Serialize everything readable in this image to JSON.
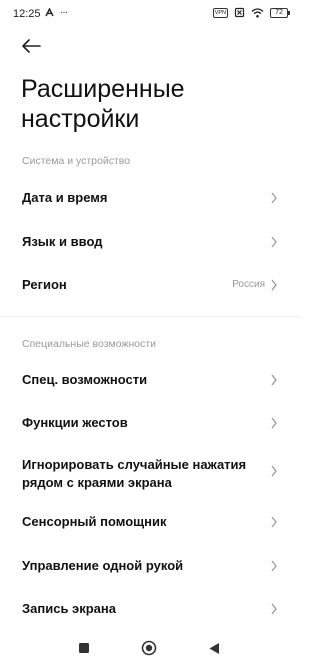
{
  "status_bar": {
    "time": "12:25",
    "vpn": "VPN",
    "battery": "72",
    "more_dots": "···"
  },
  "page": {
    "title": "Расширенные настройки"
  },
  "sections": [
    {
      "header": "Система и устройство",
      "items": [
        {
          "label": "Дата и время",
          "value": ""
        },
        {
          "label": "Язык и ввод",
          "value": ""
        },
        {
          "label": "Регион",
          "value": "Россия"
        }
      ]
    },
    {
      "header": "Специальные возможности",
      "items": [
        {
          "label": "Спец. возможности",
          "value": ""
        },
        {
          "label": "Функции жестов",
          "value": ""
        },
        {
          "label": "Игнорировать случайные нажатия рядом с краями экрана",
          "value": ""
        },
        {
          "label": "Сенсорный помощник",
          "value": ""
        },
        {
          "label": "Управление одной рукой",
          "value": ""
        },
        {
          "label": "Запись экрана",
          "value": ""
        }
      ]
    }
  ],
  "icons": {
    "back": "arrow-left-icon",
    "chevron": "chevron-right-icon",
    "nav_recents": "square-icon",
    "nav_home": "circle-icon",
    "nav_back": "triangle-back-icon"
  }
}
